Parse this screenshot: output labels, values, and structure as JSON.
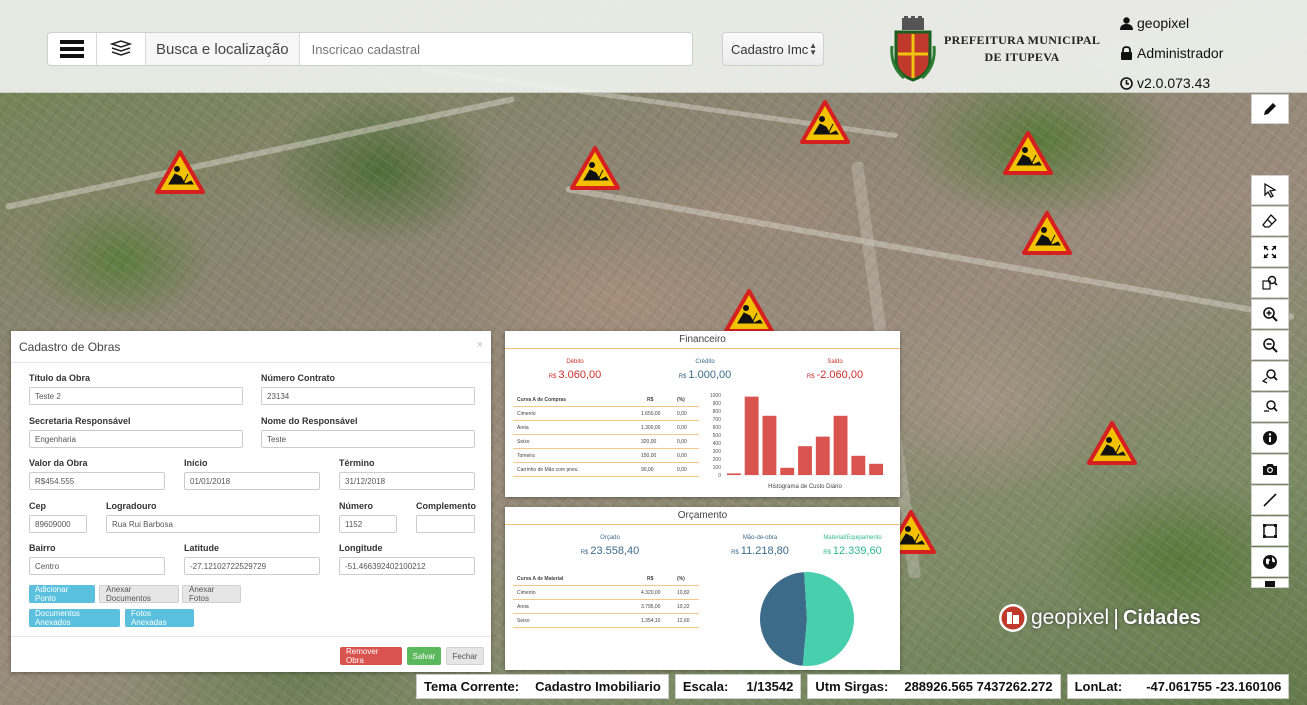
{
  "header": {
    "search_label": "Busca e localização",
    "search_placeholder": "Inscricao cadastral",
    "layer_select": "Cadastro Imc",
    "pref_line1": "PREFEITURA MUNICIPAL",
    "pref_line2": "DE ITUPEVA",
    "user_name": "geopixel",
    "user_role": "Administrador",
    "version": "v2.0.073.43"
  },
  "form": {
    "title": "Cadastro de Obras",
    "close": "×",
    "titulo_label": "Título da Obra",
    "titulo_value": "Teste 2",
    "contrato_label": "Número Contrato",
    "contrato_value": "23134",
    "secretaria_label": "Secretaria Responsável",
    "secretaria_value": "Engenharia",
    "responsavel_label": "Nome do Responsável",
    "responsavel_value": "Teste",
    "valor_label": "Valor da Obra",
    "valor_value": "R$454.555",
    "inicio_label": "Início",
    "inicio_value": "01/01/2018",
    "termino_label": "Término",
    "termino_value": "31/12/2018",
    "cep_label": "Cep",
    "cep_value": "89609000",
    "logradouro_label": "Logradouro",
    "logradouro_value": "Rua Rui Barbosa",
    "numero_label": "Número",
    "numero_value": "1152",
    "complemento_label": "Complemento",
    "complemento_value": "",
    "bairro_label": "Bairro",
    "bairro_value": "Centro",
    "latitude_label": "Latitude",
    "latitude_value": "-27.12102722529729",
    "longitude_label": "Longitude",
    "longitude_value": "-51.466392402100212",
    "btn_adicionar": "Adicionar Ponto",
    "btn_anexar_docs": "Anexar Documentos",
    "btn_anexar_fotos": "Anexar Fotos",
    "btn_docs_anexados": "Documentos Anexados",
    "btn_fotos_anexadas": "Fotos Anexadas",
    "btn_remover": "Remover Obra",
    "btn_salvar": "Salvar",
    "btn_fechar": "Fechar"
  },
  "financeiro": {
    "title": "Financeiro",
    "debito_label": "Débito",
    "debito_cur": "R$",
    "debito_value": "3.060,00",
    "credito_label": "Crédito",
    "credito_cur": "R$",
    "credito_value": "1.000,00",
    "saldo_label": "Saldo",
    "saldo_cur": "R$",
    "saldo_value": "-2.060,00",
    "table_head": [
      "Curva A de Compras",
      "R$",
      "(%)"
    ],
    "table_rows": [
      [
        "Cimento",
        "1.650,00",
        "0,00"
      ],
      [
        "Areia",
        "1.300,00",
        "0,00"
      ],
      [
        "Seixo",
        "320,00",
        "0,00"
      ],
      [
        "Tomeira",
        "150,00",
        "0,00"
      ],
      [
        "Carrinho de Mão com pneu",
        "90,00",
        "0,00"
      ]
    ]
  },
  "orcamento": {
    "title": "Orçamento",
    "orcado_label": "Orçado",
    "orcado_cur": "R$",
    "orcado_value": "23.558,40",
    "mao_label": "Mão-de-obra",
    "mao_cur": "R$",
    "mao_value": "11.218,80",
    "material_label": "Material/Equipamento",
    "material_cur": "R$",
    "material_value": "12.339,60",
    "table_head": [
      "Curva A de Material",
      "R$",
      "(%)"
    ],
    "table_rows": [
      [
        "Cimento",
        "4.320,00",
        "10,82"
      ],
      [
        "Areia",
        "3.795,00",
        "10,22"
      ],
      [
        "Seixo",
        "1.354,10",
        "12,60"
      ]
    ]
  },
  "chart_data": [
    {
      "type": "bar",
      "title": "Histograma de Custo Diário",
      "xlabel": "",
      "ylabel": "",
      "ylim": [
        0,
        1000
      ],
      "yticks": [
        "0",
        "100",
        "200",
        "300",
        "400",
        "500",
        "600",
        "700",
        "800",
        "900",
        "1000"
      ],
      "values": [
        20,
        980,
        740,
        90,
        360,
        480,
        740,
        240,
        140
      ],
      "color": "#d9534f",
      "grid": false
    },
    {
      "type": "pie",
      "values": [
        11218.8,
        12339.6
      ],
      "colors": [
        "#3d6b8a",
        "#48cfae"
      ]
    }
  ],
  "brand": {
    "name1": "geopixel",
    "name2": "Cidades"
  },
  "status": {
    "tema_label": "Tema Corrente:",
    "tema_value": "Cadastro Imobiliario",
    "escala_label": "Escala:",
    "escala_value": "1/13542",
    "utm_label": "Utm Sirgas:",
    "utm_value": "288926.565 7437262.272",
    "lonlat_label": "LonLat:",
    "lonlat_value": "-47.061755 -23.160106"
  },
  "colors": {
    "accent": "#5bc0de",
    "danger": "#d9534f",
    "success": "#5cb85c",
    "warning": "#f2c200"
  }
}
